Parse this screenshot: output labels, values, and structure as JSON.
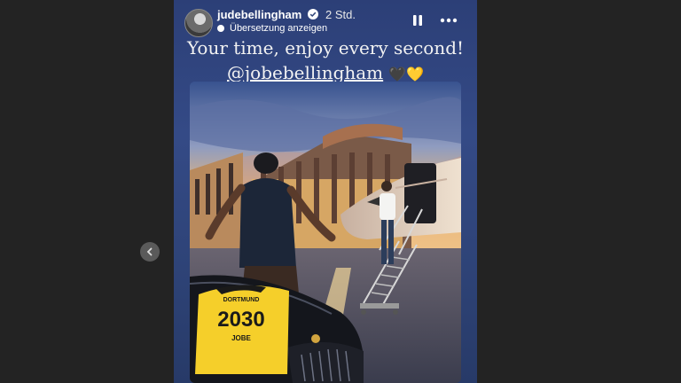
{
  "story": {
    "username": "judebellingham",
    "time_ago": "2 Std.",
    "translate_label": "Übersetzung anzeigen",
    "caption_line1": "Your time, enjoy every second!",
    "caption_mention": "@jobebellingham",
    "caption_emoji": "🖤💛"
  },
  "artwork": {
    "shirt_club": "DORTMUND",
    "shirt_number": "2030",
    "shirt_name": "JOBE"
  },
  "icons": {
    "verified": "verified-badge-icon",
    "pause": "pause-icon",
    "more": "more-options-icon",
    "previous": "chevron-left-icon"
  },
  "colors": {
    "accent_yellow": "#f5cf2a",
    "background_blue": "#2f4478"
  }
}
